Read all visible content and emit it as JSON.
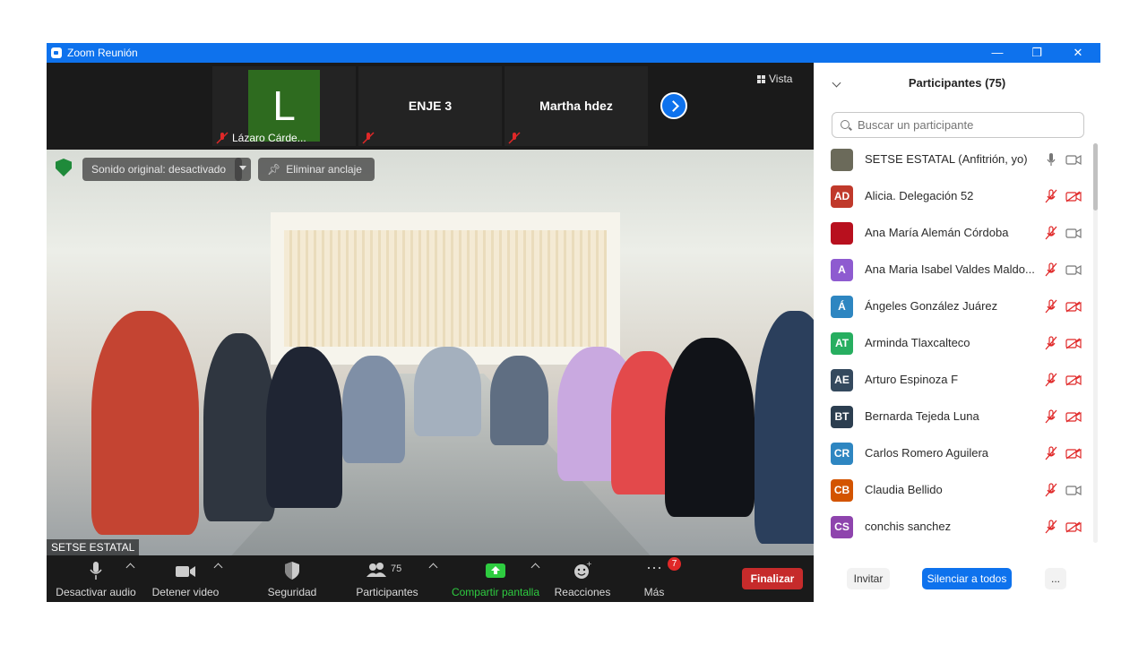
{
  "window": {
    "title": "Zoom Reunión",
    "minimize_glyph": "—",
    "restore_glyph": "❐",
    "close_glyph": "✕"
  },
  "top_strip": {
    "tiles": [
      {
        "name": "Lázaro Cárde...",
        "avatar_letter": "L",
        "avatar_color": "#2e6b1f"
      },
      {
        "name": "ENJE 3"
      },
      {
        "name": "Martha hdez"
      }
    ],
    "vista_label": "Vista"
  },
  "main_video": {
    "speaker_name": "SETSE ESTATAL",
    "sound_pill": "Sonido original: desactivado",
    "unpin_pill": "Eliminar anclaje"
  },
  "toolbar": {
    "mute": "Desactivar audio",
    "video": "Detener video",
    "security": "Seguridad",
    "participants": "Participantes",
    "participants_count": "75",
    "share": "Compartir pantalla",
    "reactions": "Reacciones",
    "more": "Más",
    "more_badge": "7",
    "end": "Finalizar",
    "accent_share": "#2ecc40",
    "end_color": "#c62b2b"
  },
  "panel": {
    "title": "Participantes (75)",
    "search_placeholder": "Buscar un participante",
    "participants": [
      {
        "name": "SETSE ESTATAL (Anfitrión, yo)",
        "initials": "",
        "color": "#6b6a5a",
        "mic": "on",
        "cam": "on"
      },
      {
        "name": "Alicia. Delegación 52",
        "initials": "AD",
        "color": "#c0392b",
        "mic": "muted",
        "cam": "off"
      },
      {
        "name": "Ana María Alemán Córdoba",
        "initials": "",
        "color": "#b8101e",
        "mic": "muted",
        "cam": "on"
      },
      {
        "name": "Ana Maria Isabel Valdes Maldo...",
        "initials": "A",
        "color": "#8e5bd0",
        "mic": "muted",
        "cam": "on"
      },
      {
        "name": "Ángeles González Juárez",
        "initials": "Á",
        "color": "#2e86c1",
        "mic": "muted",
        "cam": "off"
      },
      {
        "name": "Arminda Tlaxcalteco",
        "initials": "AT",
        "color": "#27ae60",
        "mic": "muted",
        "cam": "off"
      },
      {
        "name": "Arturo Espinoza F",
        "initials": "AE",
        "color": "#34495e",
        "mic": "muted",
        "cam": "off"
      },
      {
        "name": "Bernarda Tejeda Luna",
        "initials": "BT",
        "color": "#2c3e50",
        "mic": "muted",
        "cam": "off"
      },
      {
        "name": "Carlos Romero Aguilera",
        "initials": "CR",
        "color": "#2e86c1",
        "mic": "muted",
        "cam": "off"
      },
      {
        "name": "Claudia Bellido",
        "initials": "CB",
        "color": "#d35400",
        "mic": "muted",
        "cam": "on"
      },
      {
        "name": "conchis sanchez",
        "initials": "CS",
        "color": "#8e44ad",
        "mic": "muted",
        "cam": "off"
      }
    ],
    "invite": "Invitar",
    "mute_all": "Silenciar a todos",
    "more": "...",
    "mute_all_color": "#0e72ed"
  }
}
